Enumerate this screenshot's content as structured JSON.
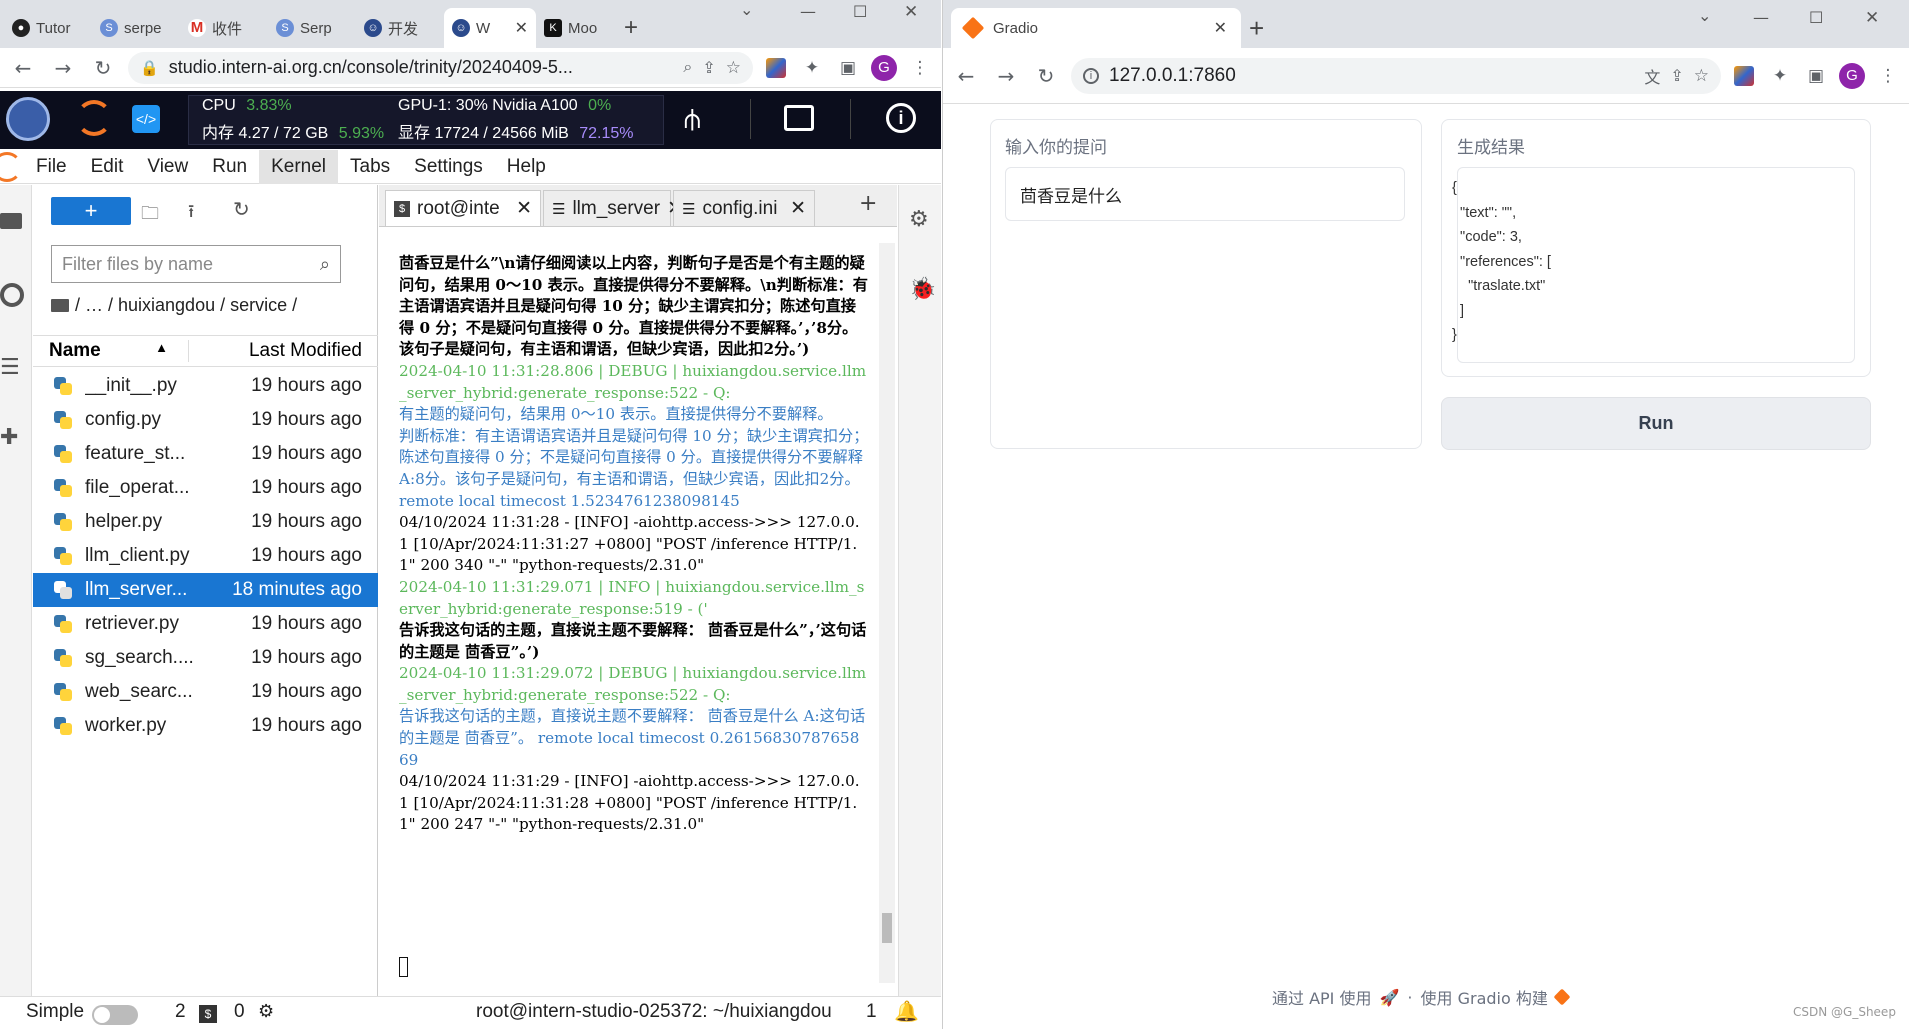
{
  "left_browser": {
    "tabs": [
      {
        "label": "Tutor",
        "icon": "github-icon"
      },
      {
        "label": "serpe",
        "icon": "s-icon"
      },
      {
        "label": "收件",
        "icon": "gmail-icon"
      },
      {
        "label": "Serp",
        "icon": "s-icon"
      },
      {
        "label": "开发",
        "icon": "intern-icon"
      },
      {
        "label": "W",
        "icon": "intern-icon"
      },
      {
        "label": "Moo",
        "icon": "k-icon"
      }
    ],
    "url": "studio.intern-ai.org.cn/console/trinity/20240409-5...",
    "avatar": "G"
  },
  "studio_bar": {
    "cpu_label": "CPU",
    "cpu_pct": "3.83%",
    "mem_label": "内存",
    "mem_value": "4.27 / 72 GB",
    "mem_pct": "5.93%",
    "gpu_label": "GPU-1: 30% Nvidia A100",
    "gpu_pct": "0%",
    "vram_label": "显存",
    "vram_value": "17724 / 24566 MiB",
    "vram_pct": "72.15%"
  },
  "menu": [
    "File",
    "Edit",
    "View",
    "Run",
    "Kernel",
    "Tabs",
    "Settings",
    "Help"
  ],
  "filebrowser": {
    "filter_placeholder": "Filter files by name",
    "breadcrumb": "/ … / huixiangdou / service /",
    "col_name": "Name",
    "col_modified": "Last Modified",
    "files": [
      {
        "name": "__init__.py",
        "modified": "19 hours ago"
      },
      {
        "name": "config.py",
        "modified": "19 hours ago"
      },
      {
        "name": "feature_st...",
        "modified": "19 hours ago"
      },
      {
        "name": "file_operat...",
        "modified": "19 hours ago"
      },
      {
        "name": "helper.py",
        "modified": "19 hours ago"
      },
      {
        "name": "llm_client.py",
        "modified": "19 hours ago"
      },
      {
        "name": "llm_server...",
        "modified": "18 minutes ago",
        "selected": true
      },
      {
        "name": "retriever.py",
        "modified": "19 hours ago"
      },
      {
        "name": "sg_search....",
        "modified": "19 hours ago"
      },
      {
        "name": "web_searc...",
        "modified": "19 hours ago"
      },
      {
        "name": "worker.py",
        "modified": "19 hours ago"
      }
    ]
  },
  "terminal": {
    "tabs": [
      "root@inte",
      "llm_server",
      "config.ini"
    ],
    "lines": [
      {
        "cls": "k bold",
        "text": "茴香豆是什么”\\n请仔细阅读以上内容，判断句子是否是个有主题的疑问句，结果用 0～10 表示。直接提供得分不要解释。\\n判断标准：有主语谓语宾语并且是疑问句得 10 分；缺少主谓宾扣分；陈述句直接得 0 分；不是疑问句直接得 0 分。直接提供得分不要解释。’，’8分。该句子是疑问句，有主语和谓语，但缺少宾语，因此扣2分。’)"
      },
      {
        "cls": "g",
        "text": "2024-04-10 11:31:28.806 | DEBUG    | huixiangdou.service.llm_server_hybrid:generate_response:522 - Q:"
      },
      {
        "cls": "b",
        "text": "有主题的疑问句，结果用 0～10 表示。直接提供得分不要解释。"
      },
      {
        "cls": "b",
        "text": "判断标准：有主语谓语宾语并且是疑问句得 10 分；缺少主谓宾扣分；陈述句直接得 0 分；不是疑问句直接得 0 分。直接提供得分不要解释 A:8分。该句子是疑问句，有主语和谓语，但缺少宾语，因此扣2分。             remote local timecost 1.5234761238098145"
      },
      {
        "cls": "k",
        "text": "04/10/2024 11:31:28 - [INFO] -aiohttp.access->>> 127.0.0.1 [10/Apr/2024:11:31:27 +0800] \"POST /inference HTTP/1.1\" 200 340 \"-\" \"python-requests/2.31.0\""
      },
      {
        "cls": "g",
        "text": "2024-04-10 11:31:29.071 | INFO     | huixiangdou.service.llm_server_hybrid:generate_response:519 - ('"
      },
      {
        "cls": "k bold",
        "text": "告诉我这句话的主题，直接说主题不要解释： 茴香豆是什么”，’这句话的主题是 茴香豆”。’)"
      },
      {
        "cls": "g",
        "text": "2024-04-10 11:31:29.072 | DEBUG    | huixiangdou.service.llm_server_hybrid:generate_response:522 - Q:"
      },
      {
        "cls": "b",
        "text": "告诉我这句话的主题，直接说主题不要解释： 茴香豆是什么 A:这句话的主题是 茴香豆”。          remote local timecost 0.2615683078765869"
      },
      {
        "cls": "k",
        "text": "04/10/2024 11:31:29 - [INFO] -aiohttp.access->>> 127.0.0.1 [10/Apr/2024:11:31:28 +0800] \"POST /inference HTTP/1.1\" 200 247 \"-\" \"python-requests/2.31.0\""
      }
    ]
  },
  "statusbar": {
    "mode": "Simple",
    "num_terminals": "2",
    "num_kernels": "0",
    "path": "root@intern-studio-025372: ~/huixiangdou",
    "count": "1"
  },
  "right_browser": {
    "tab_title": "Gradio",
    "url": "127.0.0.1:7860",
    "avatar": "G"
  },
  "gradio": {
    "input_label": "输入你的提问",
    "input_value": "茴香豆是什么",
    "output_label": "生成结果",
    "output_json": "{\n  \"text\": \"\",\n  \"code\": 3,\n  \"references\": [\n    \"traslate.txt\"\n  ]\n}",
    "run_label": "Run",
    "footer_api": "通过 API 使用",
    "footer_sep": "·",
    "footer_built": "使用 Gradio 构建",
    "watermark": "CSDN @G_Sheep"
  },
  "colors": {
    "accent": "#1976d2",
    "studio_bg": "#0b0d1c",
    "green": "#4caf50",
    "purple": "#a78bfa",
    "term_green": "#5cb85c",
    "term_blue": "#3a7ec4"
  }
}
